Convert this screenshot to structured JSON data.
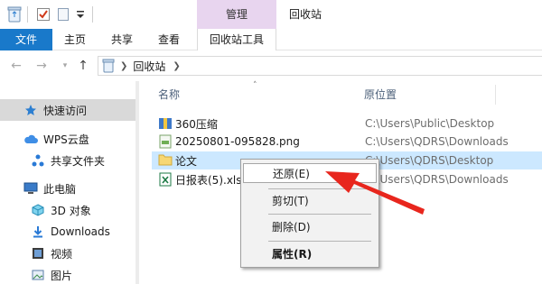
{
  "window": {
    "title": "回收站",
    "context_tab": "管理"
  },
  "ribbon": {
    "tabs": [
      "文件",
      "主页",
      "共享",
      "查看",
      "回收站工具"
    ]
  },
  "address": {
    "path": "回收站"
  },
  "sidebar": {
    "items": [
      {
        "label": "快速访问",
        "icon": "star-icon"
      },
      {
        "label": "WPS云盘",
        "icon": "cloud-icon"
      },
      {
        "label": "共享文件夹",
        "icon": "share-icon"
      },
      {
        "label": "此电脑",
        "icon": "computer-icon"
      },
      {
        "label": "3D 对象",
        "icon": "cube-icon"
      },
      {
        "label": "Downloads",
        "icon": "download-icon"
      },
      {
        "label": "视频",
        "icon": "video-icon"
      },
      {
        "label": "图片",
        "icon": "picture-icon"
      }
    ]
  },
  "filelist": {
    "columns": {
      "name": "名称",
      "location": "原位置"
    },
    "rows": [
      {
        "name": "360压缩",
        "location": "C:\\Users\\Public\\Desktop",
        "icon": "archive-icon"
      },
      {
        "name": "20250801-095828.png",
        "location": "C:\\Users\\QDRS\\Downloads",
        "icon": "image-file-icon"
      },
      {
        "name": "论文",
        "location": "C:\\Users\\QDRS\\Desktop",
        "icon": "folder-icon"
      },
      {
        "name": "日报表(5).xlsx",
        "location": "C:\\Users\\QDRS\\Downloads",
        "icon": "excel-file-icon"
      }
    ]
  },
  "context_menu": {
    "items": [
      "还原(E)",
      "剪切(T)",
      "删除(D)",
      "属性(R)"
    ]
  },
  "colors": {
    "accent": "#1979ca",
    "context_tab": "#e8d5ef",
    "selection": "#cce8ff",
    "arrow": "#e8261d"
  }
}
